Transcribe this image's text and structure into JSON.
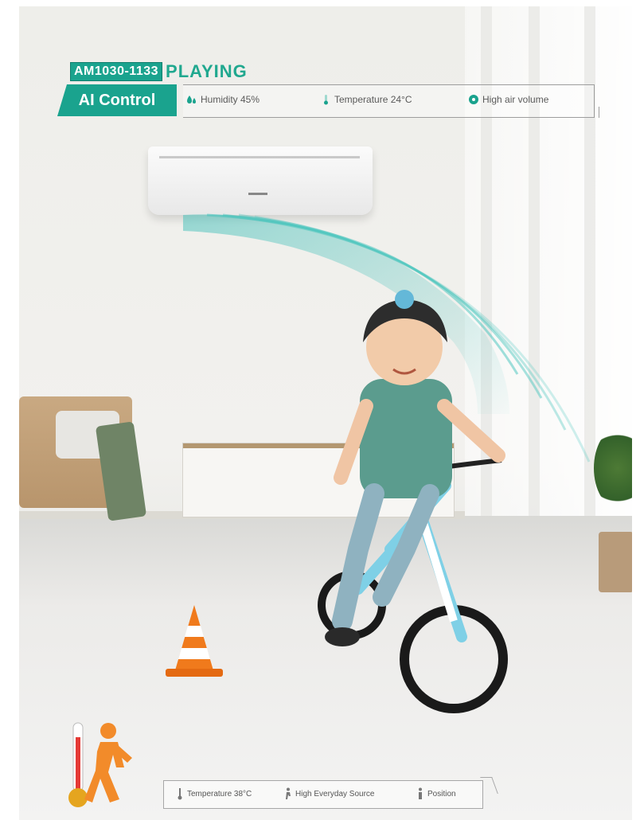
{
  "header": {
    "model": "AM1030-1133",
    "mode": "PLAYING"
  },
  "ai_bar": {
    "title": "AI Control",
    "items": [
      {
        "icon": "humidity-icon",
        "label": "Humidity 45%"
      },
      {
        "icon": "thermometer-icon",
        "label": "Temperature 24°C"
      },
      {
        "icon": "fan-icon",
        "label": "High air volume"
      }
    ]
  },
  "status_bar": {
    "items": [
      {
        "icon": "thermometer-icon",
        "label": "Temperature 38°C"
      },
      {
        "icon": "walking-person-icon",
        "label": "High Everyday Source"
      },
      {
        "icon": "person-icon",
        "label": "Position"
      }
    ]
  },
  "colors": {
    "accent": "#1aa38e",
    "airflow": "#4fc9c2",
    "cone": "#f07a1c",
    "person_heat": "#f28b2a"
  }
}
